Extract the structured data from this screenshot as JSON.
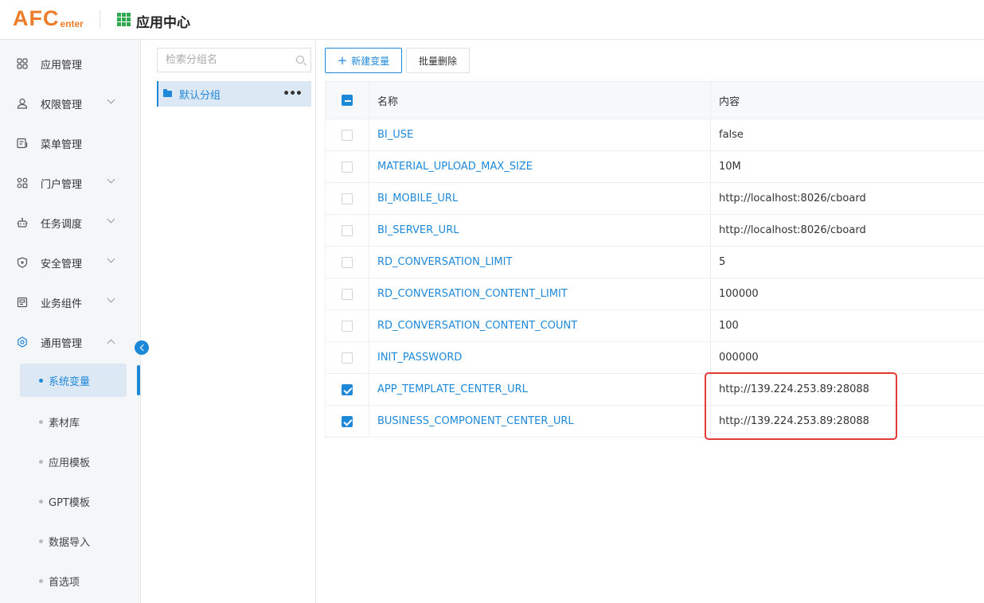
{
  "header": {
    "logo_main": "AFC",
    "logo_sub": "enter",
    "title": "应用中心"
  },
  "sidebar": {
    "items": [
      {
        "label": "应用管理",
        "icon": "apps-icon",
        "expandable": false
      },
      {
        "label": "权限管理",
        "icon": "user-icon",
        "expandable": true
      },
      {
        "label": "菜单管理",
        "icon": "menu-doc-icon",
        "expandable": false
      },
      {
        "label": "门户管理",
        "icon": "portal-icon",
        "expandable": true
      },
      {
        "label": "任务调度",
        "icon": "robot-icon",
        "expandable": true
      },
      {
        "label": "安全管理",
        "icon": "shield-icon",
        "expandable": true
      },
      {
        "label": "业务组件",
        "icon": "component-icon",
        "expandable": true
      },
      {
        "label": "通用管理",
        "icon": "settings-icon",
        "expandable": true,
        "expanded": true
      }
    ],
    "sub_items": [
      {
        "label": "系统变量",
        "active": true
      },
      {
        "label": "素材库",
        "active": false
      },
      {
        "label": "应用模板",
        "active": false
      },
      {
        "label": "GPT模板",
        "active": false
      },
      {
        "label": "数据导入",
        "active": false
      },
      {
        "label": "首选项",
        "active": false
      }
    ]
  },
  "groups": {
    "search_placeholder": "检索分组名",
    "items": [
      {
        "label": "默认分组",
        "selected": true
      }
    ]
  },
  "toolbar": {
    "new_label": "新建变量",
    "batch_delete_label": "批量删除"
  },
  "table": {
    "columns": {
      "name": "名称",
      "value": "内容"
    },
    "rows": [
      {
        "name": "BI_USE",
        "value": "false",
        "checked": false
      },
      {
        "name": "MATERIAL_UPLOAD_MAX_SIZE",
        "value": "10M",
        "checked": false
      },
      {
        "name": "BI_MOBILE_URL",
        "value": "http://localhost:8026/cboard",
        "checked": false
      },
      {
        "name": "BI_SERVER_URL",
        "value": "http://localhost:8026/cboard",
        "checked": false
      },
      {
        "name": "RD_CONVERSATION_LIMIT",
        "value": "5",
        "checked": false
      },
      {
        "name": "RD_CONVERSATION_CONTENT_LIMIT",
        "value": "100000",
        "checked": false
      },
      {
        "name": "RD_CONVERSATION_CONTENT_COUNT",
        "value": "100",
        "checked": false
      },
      {
        "name": "INIT_PASSWORD",
        "value": "000000",
        "checked": false
      },
      {
        "name": "APP_TEMPLATE_CENTER_URL",
        "value": "http://139.224.253.89:28088",
        "checked": true
      },
      {
        "name": "BUSINESS_COMPONENT_CENTER_URL",
        "value": "http://139.224.253.89:28088",
        "checked": true
      }
    ]
  },
  "colors": {
    "accent": "#1e88d8",
    "logo": "#ee7d2b",
    "app_grid": "#2fa84f",
    "highlight": "#e53935"
  }
}
